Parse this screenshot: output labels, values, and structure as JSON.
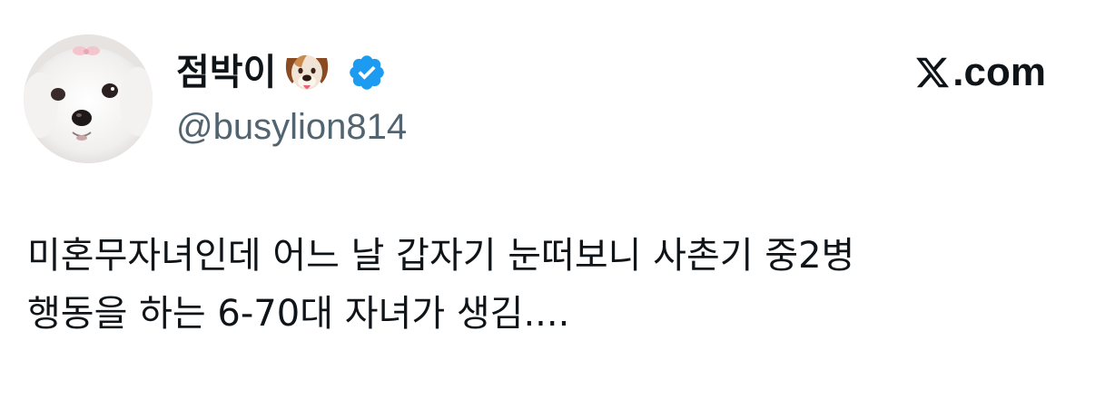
{
  "tweet": {
    "author": {
      "display_name": "점박이",
      "display_name_emoji": "dog-face-icon",
      "verified": true,
      "handle": "@busylion814",
      "avatar": "white-maltese-dog-photo"
    },
    "brand": {
      "logo": "x-logo-icon",
      "text": ".com"
    },
    "text_lines": [
      "미혼무자녀인데 어느 날 갑자기 눈떠보니 사촌기 중2병",
      "행동을 하는 6-70대 자녀가 생김...."
    ]
  },
  "colors": {
    "text_primary": "#0f1419",
    "text_secondary": "#536471",
    "verified_blue": "#1d9bf0",
    "background": "#ffffff"
  }
}
